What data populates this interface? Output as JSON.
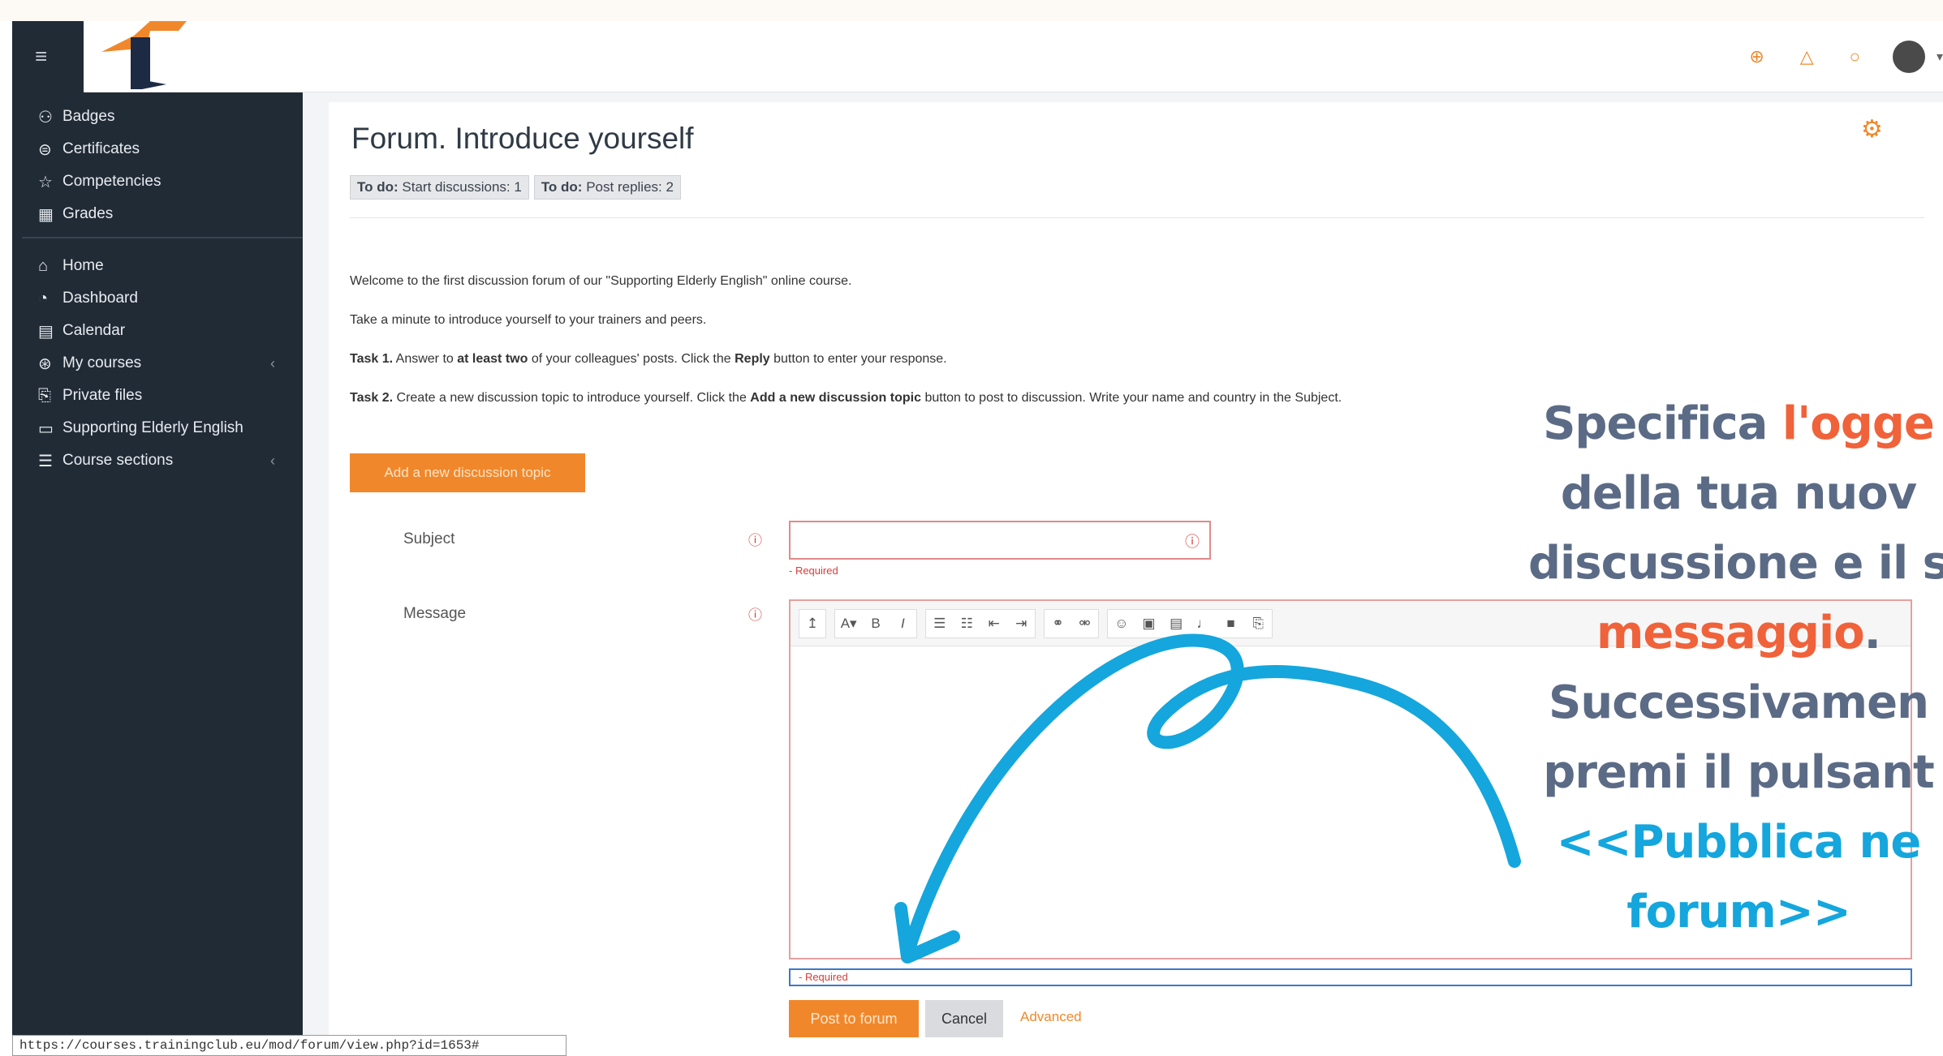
{
  "navbar": {
    "menu_icon": "menu-icon",
    "icons": [
      "globe-icon",
      "bell-icon",
      "chat-icon"
    ]
  },
  "sidebar": {
    "items": [
      {
        "label": "Badges",
        "icon": "badge-icon"
      },
      {
        "label": "Certificates",
        "icon": "certificate-icon"
      },
      {
        "label": "Competencies",
        "icon": "star-icon"
      },
      {
        "label": "Grades",
        "icon": "grades-icon"
      },
      {
        "label": "Home",
        "icon": "home-icon"
      },
      {
        "label": "Dashboard",
        "icon": "dashboard-icon"
      },
      {
        "label": "Calendar",
        "icon": "calendar-icon"
      },
      {
        "label": "My courses",
        "icon": "courses-icon"
      },
      {
        "label": "Private files",
        "icon": "files-icon"
      },
      {
        "label": "Supporting Elderly English",
        "icon": "folder-icon"
      },
      {
        "label": "Course sections",
        "icon": "list-icon"
      }
    ]
  },
  "forum": {
    "title": "Forum. Introduce yourself",
    "todo1_prefix": "To do:",
    "todo1": "Start discussions: 1",
    "todo2_prefix": "To do:",
    "todo2": "Post replies: 2",
    "p1": "Welcome to the first discussion forum of our \"Supporting Elderly English\" online course.",
    "p2": "Take a minute to introduce yourself to your trainers and peers.",
    "p3_a": "Task 1.",
    "p3_b": " Answer to ",
    "p3_c": "at least two",
    "p3_d": " of your colleagues' posts. Click the ",
    "p3_e": "Reply",
    "p3_f": " button to enter your response.",
    "p4_a": "Task 2.",
    "p4_b": " Create a new discussion topic to introduce yourself. Click the ",
    "p4_c": "Add a new discussion topic",
    "p4_d": " button to post to discussion. Write your name and country in the Subject.",
    "add_button": "Add a new discussion topic"
  },
  "form": {
    "subject_label": "Subject",
    "message_label": "Message",
    "required": "- Required",
    "required2": "- Required",
    "post_button": "Post to forum",
    "cancel_button": "Cancel",
    "advanced_link": "Advanced"
  },
  "toolbar": {
    "group1": [
      "↥"
    ],
    "group2": [
      "A▾",
      "B",
      "I"
    ],
    "group3": [
      "☰",
      "☷",
      "⇤",
      "⇥"
    ],
    "group4": [
      "🔗",
      "⛓"
    ],
    "group5": [
      "☺",
      "▣",
      "▤",
      "🎤",
      "■",
      "⎘"
    ]
  },
  "status_url": "https://courses.trainingclub.eu/mod/forum/view.php?id=1653#",
  "overlay": {
    "l1a": "Specifica ",
    "l1b": "l'ogge",
    "l2": "della tua nuov",
    "l3": "discussione e il s",
    "l4": "messaggio",
    "l4b": ".",
    "l5": "Successivamen",
    "l6": "premi il pulsant",
    "l7": "<<Pubblica ne",
    "l8": "forum>>"
  },
  "colors": {
    "sidebar": "#212b36",
    "accent": "#f0882b",
    "overlay_text": "#5b6b86",
    "overlay_highlight": "#f0623a",
    "overlay_blue": "#14a6dd",
    "arrow": "#14a6dd"
  }
}
